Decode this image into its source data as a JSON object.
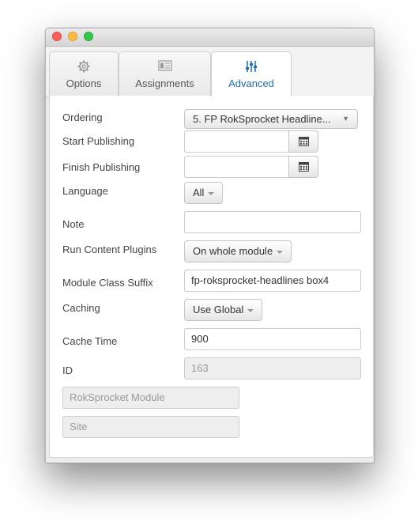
{
  "tabs": [
    {
      "label": "Options",
      "icon": "gear-icon"
    },
    {
      "label": "Assignments",
      "icon": "list-icon"
    },
    {
      "label": "Advanced",
      "icon": "sliders-icon"
    }
  ],
  "form": {
    "ordering": {
      "label": "Ordering",
      "value": "5. FP RokSprocket Headline..."
    },
    "start_publishing": {
      "label": "Start Publishing",
      "value": ""
    },
    "finish_publishing": {
      "label": "Finish Publishing",
      "value": ""
    },
    "language": {
      "label": "Language",
      "value": "All"
    },
    "note": {
      "label": "Note",
      "value": ""
    },
    "run_content_plugins": {
      "label": "Run Content Plugins",
      "value": "On whole module"
    },
    "module_class_suffix": {
      "label": "Module Class Suffix",
      "value": "fp-roksprocket-headlines box4"
    },
    "caching": {
      "label": "Caching",
      "value": "Use Global"
    },
    "cache_time": {
      "label": "Cache Time",
      "value": "900"
    },
    "id": {
      "label": "ID",
      "value": "163"
    },
    "module_type": "RokSprocket Module",
    "client": "Site"
  },
  "colors": {
    "active_tab_text": "#1f6fb8"
  }
}
